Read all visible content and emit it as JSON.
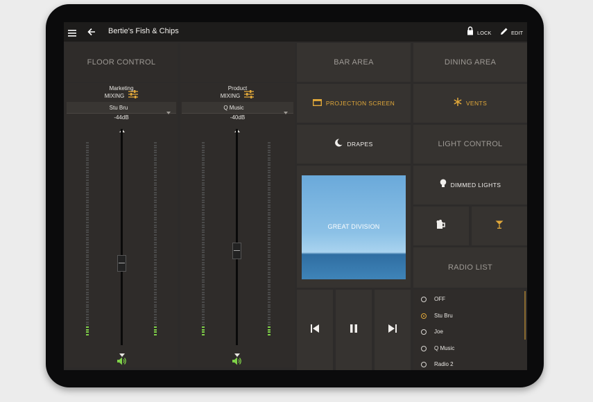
{
  "header": {
    "title": "Bertie's Fish & Chips",
    "lock_label": "LOCK",
    "edit_label": "EDIT"
  },
  "floor_control": {
    "title": "FLOOR CONTROL",
    "channels": [
      {
        "name": "Marketing",
        "mode_label": "MIXING",
        "source": "Stu Bru",
        "level": "-44dB"
      },
      {
        "name": "Product",
        "mode_label": "MIXING",
        "source": "Q Music",
        "level": "-40dB"
      }
    ]
  },
  "bar_area": {
    "title": "BAR AREA",
    "projection_label": "PROJECTION SCREEN",
    "drapes_label": "DRAPES"
  },
  "dining_area": {
    "title": "DINING AREA",
    "vents_label": "VENTS"
  },
  "light_control": {
    "title": "LIGHT CONTROL",
    "dimmed_label": "DIMMED LIGHTS"
  },
  "now_playing": {
    "album_text": "GREAT DIVISION"
  },
  "radio_list": {
    "title": "RADIO LIST",
    "selected": "Stu Bru",
    "items": [
      "OFF",
      "Stu Bru",
      "Joe",
      "Q Music",
      "Radio 2"
    ]
  },
  "colors": {
    "accent": "#e2a93a",
    "meter_green": "#7fd148",
    "tile": "#363330",
    "background": "#2d2b2a"
  }
}
